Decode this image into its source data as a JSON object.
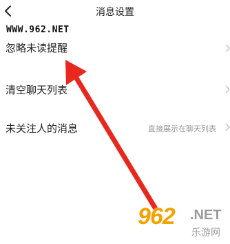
{
  "header": {
    "title": "消息设置",
    "back_icon": "chevron-left-icon"
  },
  "watermark_top": "WWW.962.NET",
  "settings": [
    {
      "label": "忽略未读提醒",
      "value": ""
    },
    {
      "label": "清空聊天列表",
      "value": ""
    },
    {
      "label": "未关注人的消息",
      "value": "直接展示在聊天列表"
    }
  ],
  "annotation": {
    "arrow_color": "#e8281e"
  },
  "watermark_bottom": {
    "number": "962",
    "domain": ".NET",
    "chinese": "乐游网"
  }
}
